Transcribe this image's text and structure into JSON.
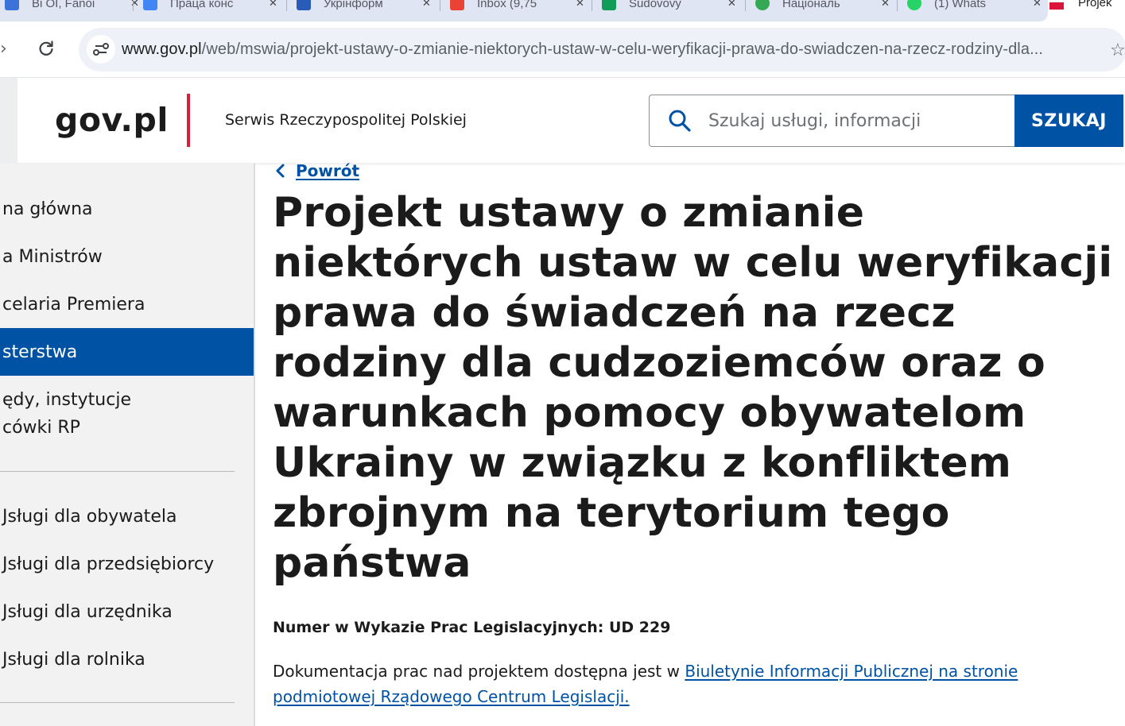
{
  "browser": {
    "tabs": [
      {
        "title": "Ві OI, Fanoi",
        "icon": "tab-favicon",
        "color": "#3b73d9"
      },
      {
        "title": "Праца конс",
        "icon": "tab-favicon",
        "color": "#4285f4"
      },
      {
        "title": "Укрінформ",
        "icon": "tab-favicon",
        "color": "#2a5bb8"
      },
      {
        "title": "Inbox (9,75",
        "icon": "gmail-favicon",
        "color": "#ea4335"
      },
      {
        "title": "Sudovovy",
        "icon": "sheets-favicon",
        "color": "#0f9d58"
      },
      {
        "title": "Національ",
        "icon": "tab-favicon",
        "color": "#34a853"
      },
      {
        "title": "(1) Whats",
        "icon": "whatsapp-favicon",
        "color": "#25d366"
      }
    ],
    "active_tab": {
      "title": "Projek",
      "icon": "gov-favicon"
    },
    "url": {
      "host": "www.gov.pl",
      "path": "/web/mswia/projekt-ustawy-o-zmianie-niektorych-ustaw-w-celu-weryfikacji-prawa-do-swiadczen-na-rzecz-rodziny-dla..."
    }
  },
  "header": {
    "logo": "gov.pl",
    "service_name": "Serwis Rzeczypospolitej Polskiej",
    "search_placeholder": "Szukaj usługi, informacji",
    "search_button": "SZUKAJ",
    "accent_color": "#d4213d",
    "brand_color": "#0052a5"
  },
  "sidebar": {
    "group1": [
      {
        "label": "na główna"
      },
      {
        "label": "a Ministrów"
      },
      {
        "label": "celaria Premiera"
      },
      {
        "label": "sterstwa",
        "active": true
      },
      {
        "label": "ędy, instytucje"
      },
      {
        "label": "cówki RP"
      }
    ],
    "group2": [
      {
        "label": "Jsługi dla obywatela"
      },
      {
        "label": "Jsługi dla przedsiębiorcy"
      },
      {
        "label": "Jsługi dla urzędnika"
      },
      {
        "label": "Jsługi dla rolnika"
      }
    ]
  },
  "main": {
    "back_label": "Powrót",
    "title_lines": [
      "Projekt ustawy o zmianie",
      "niektórych ustaw w celu weryfikacji",
      "prawa do świadczeń na rzecz",
      "rodziny dla cudzoziemców oraz o",
      "warunkach pomocy obywatelom",
      "Ukrainy w związku z konfliktem",
      "zbrojnym na terytorium tego",
      "państwa"
    ],
    "registry_number": "Numer w Wykazie Prac Legislacyjnych: UD 229",
    "doc_text": "Dokumentacja prac nad projektem dostępna jest w ",
    "doc_link": "Biuletynie Informacji Publicznej na stronie podmiotowej Rządowego Centrum Legislacji."
  }
}
